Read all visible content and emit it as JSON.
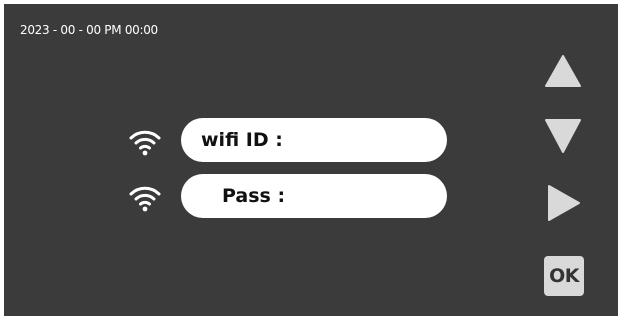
{
  "status_bar": {
    "datetime": "2023 - 00 - 00 PM 00:00"
  },
  "form": {
    "wifi_id": {
      "label": "wifi ID :",
      "icon": "wifi-icon"
    },
    "password": {
      "label": "Pass :",
      "icon": "wifi-icon"
    }
  },
  "controls": {
    "up": {
      "icon": "triangle-up-icon"
    },
    "down": {
      "icon": "triangle-down-icon"
    },
    "right": {
      "icon": "triangle-right-icon"
    },
    "ok": {
      "label": "OK"
    }
  },
  "colors": {
    "background": "#3b3b3b",
    "field": "#ffffff",
    "control": "#d9d9d9"
  }
}
